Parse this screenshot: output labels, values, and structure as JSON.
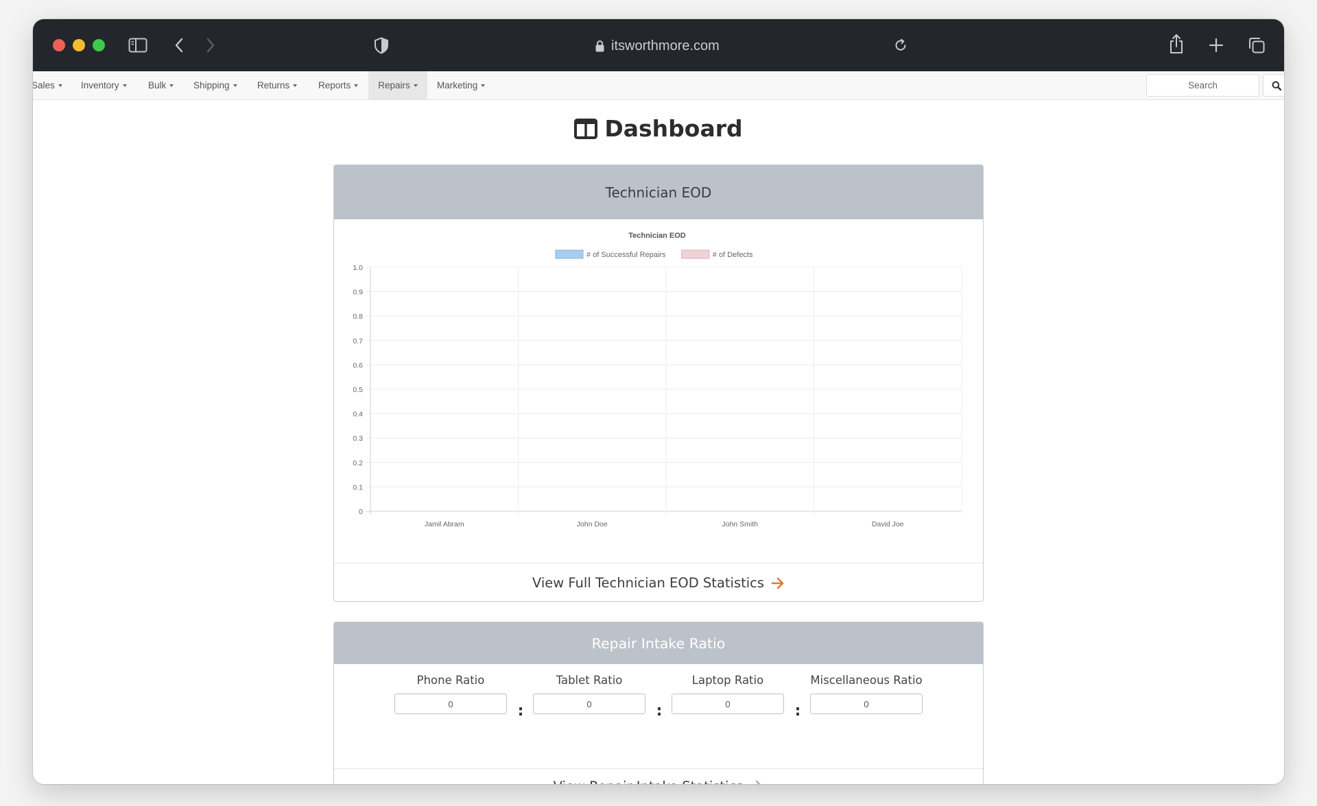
{
  "browser": {
    "url": "itsworthmore.com"
  },
  "nav": {
    "items": [
      {
        "label": "Sales",
        "active": false
      },
      {
        "label": "Inventory",
        "active": false
      },
      {
        "label": "Bulk",
        "active": false
      },
      {
        "label": "Shipping",
        "active": false
      },
      {
        "label": "Returns",
        "active": false
      },
      {
        "label": "Reports",
        "active": false
      },
      {
        "label": "Repairs",
        "active": true
      },
      {
        "label": "Marketing",
        "active": false
      }
    ],
    "search_placeholder": "Search"
  },
  "page": {
    "title": "Dashboard"
  },
  "eod_card": {
    "header": "Technician EOD",
    "footer_link": "View Full Technician EOD Statistics",
    "arrow_color": "#e8743b"
  },
  "chart_data": {
    "type": "bar",
    "title": "Technician EOD",
    "categories": [
      "Jamil Abram",
      "John Doe",
      "John Smith",
      "David Joe"
    ],
    "series": [
      {
        "name": "# of Successful Repairs",
        "values": [
          0,
          0,
          0,
          0
        ],
        "color": "#a8cdef"
      },
      {
        "name": "# of Defects",
        "values": [
          0,
          0,
          0,
          0
        ],
        "color": "#f0d3d6"
      }
    ],
    "yticks": [
      "0",
      "0.1",
      "0.2",
      "0.3",
      "0.4",
      "0.5",
      "0.6",
      "0.7",
      "0.8",
      "0.9",
      "1.0"
    ],
    "ylim": [
      0,
      1
    ],
    "legend": "top",
    "grid": true
  },
  "intake_card": {
    "header": "Repair Intake Ratio",
    "ratios": [
      {
        "label": "Phone Ratio",
        "value": "0"
      },
      {
        "label": "Tablet Ratio",
        "value": "0"
      },
      {
        "label": "Laptop Ratio",
        "value": "0"
      },
      {
        "label": "Miscellaneous Ratio",
        "value": "0"
      }
    ],
    "separator": ":",
    "footer_link": "View Repair Intake Statistics",
    "arrow_color": "#9a9a9a"
  }
}
